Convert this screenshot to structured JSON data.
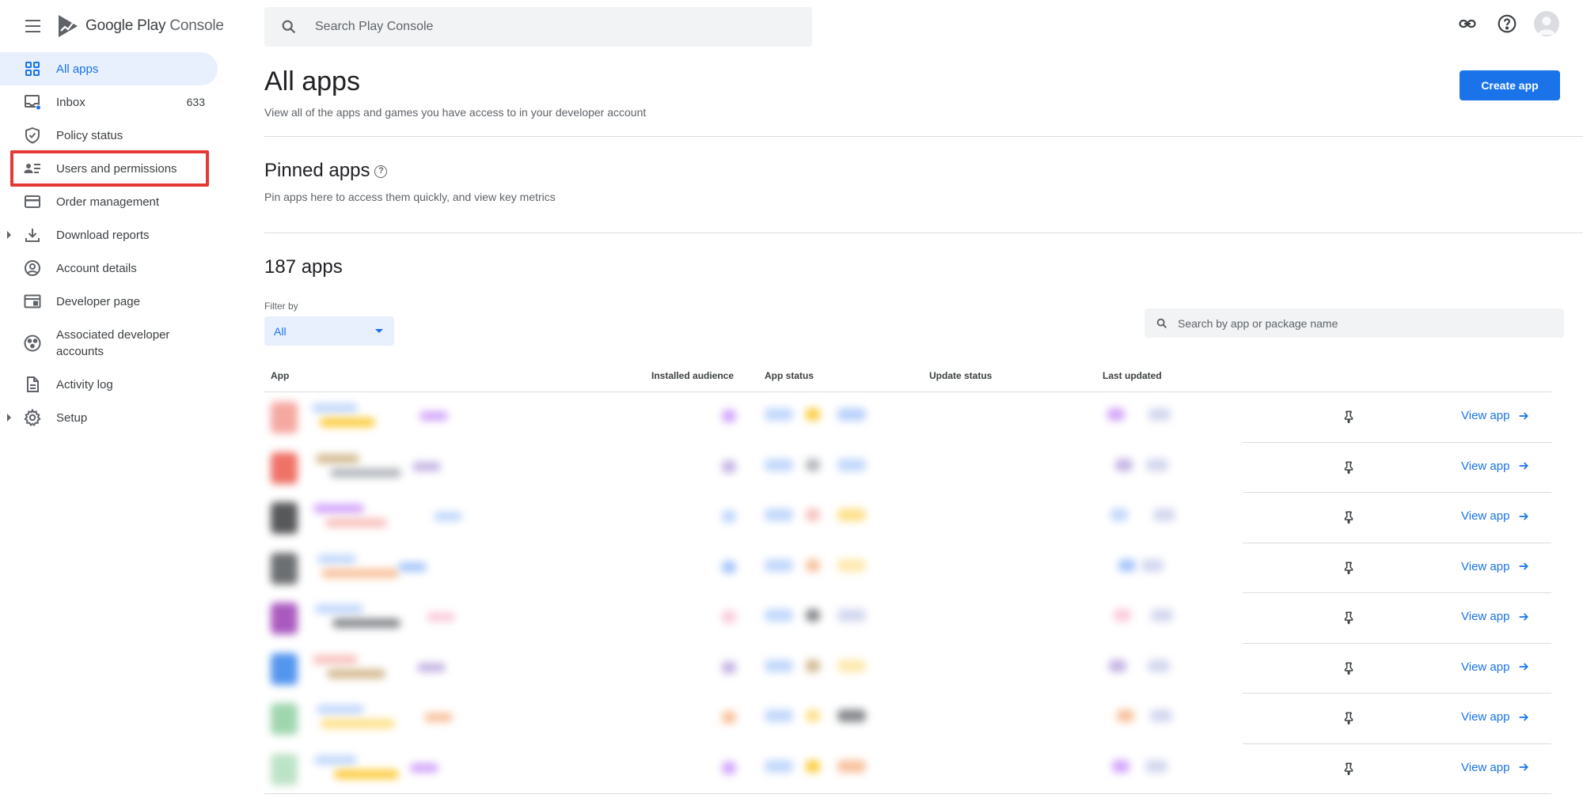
{
  "brand": {
    "google": "Google Play",
    "console": "Console"
  },
  "colors": {
    "accent": "#1a73e8",
    "highlight": "#e53935"
  },
  "sidebar": {
    "items": [
      {
        "label": "All apps",
        "icon": "grid-icon",
        "active": true
      },
      {
        "label": "Inbox",
        "icon": "inbox-icon",
        "count": "633"
      },
      {
        "label": "Policy status",
        "icon": "shield-check-icon"
      },
      {
        "label": "Users and permissions",
        "icon": "people-list-icon",
        "highlighted": true
      },
      {
        "label": "Order management",
        "icon": "credit-card-icon"
      },
      {
        "label": "Download reports",
        "icon": "download-icon",
        "expandable": true
      },
      {
        "label": "Account details",
        "icon": "account-circle-icon"
      },
      {
        "label": "Developer page",
        "icon": "web-page-icon"
      },
      {
        "label": "Associated developer accounts",
        "icon": "linked-accounts-icon"
      },
      {
        "label": "Activity log",
        "icon": "document-icon"
      },
      {
        "label": "Setup",
        "icon": "gear-icon",
        "expandable": true
      }
    ]
  },
  "search": {
    "placeholder": "Search Play Console"
  },
  "topbar": {
    "icons": [
      "link-icon",
      "help-icon",
      "avatar"
    ]
  },
  "main": {
    "title": "All apps",
    "subtitle": "View all of the apps and games you have access to in your developer account",
    "create_button": "Create app",
    "pinned": {
      "title": "Pinned apps",
      "subtitle": "Pin apps here to access them quickly, and view key metrics"
    },
    "apps_count": "187 apps",
    "filter": {
      "label": "Filter by",
      "value": "All"
    },
    "app_search": {
      "placeholder": "Search by app or package name"
    },
    "table": {
      "columns": [
        "App",
        "Installed audience",
        "App status",
        "Update status",
        "Last updated"
      ],
      "row_action": "View app",
      "row_count_visible": 8
    }
  }
}
